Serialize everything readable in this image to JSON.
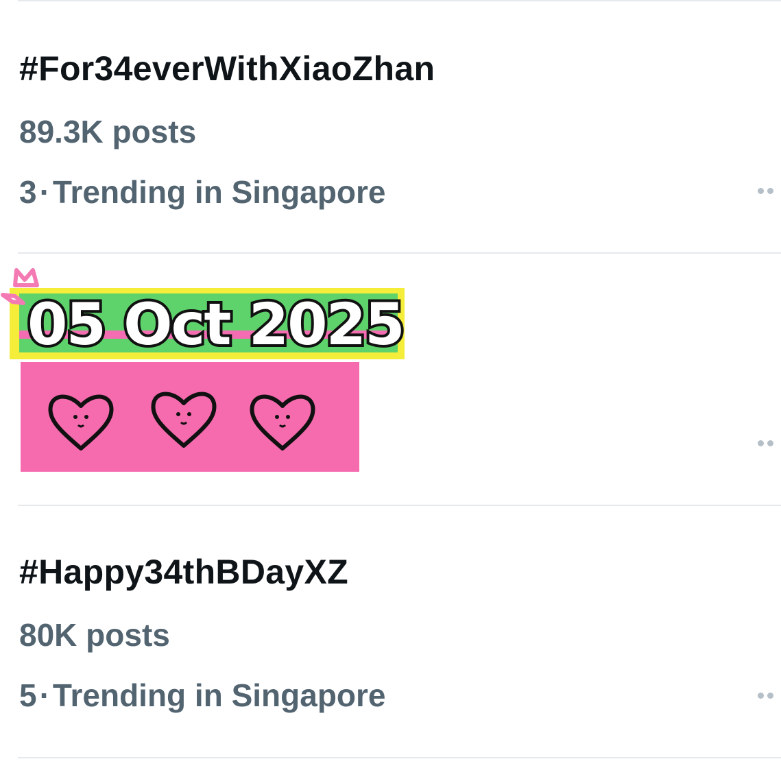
{
  "trends": [
    {
      "hashtag": "#For34everWithXiaoZhan",
      "posts": "89.3K posts",
      "rank": "3",
      "separator": "·",
      "context": "Trending in Singapore",
      "more_icon": "more-horizontal-icon"
    },
    {
      "hashtag": "#Happy34thBDayXZ",
      "posts": "80K posts",
      "rank": "5",
      "separator": "·",
      "context": "Trending in Singapore",
      "more_icon": "more-horizontal-icon"
    }
  ],
  "sticker": {
    "date": "05 Oct 2025",
    "icons": [
      "crown-icon",
      "heart-face-icon",
      "heart-face-icon",
      "heart-face-icon"
    ],
    "colors": {
      "highlight_yellow": "#f4ee3b",
      "stripe_green": "#5ed36c",
      "stripe_pink": "#f46cb1",
      "panel_pink": "#f66aae",
      "crown_pink": "#f47ab4",
      "outline": "#111111"
    }
  },
  "colors": {
    "hashtag_text": "#0f1419",
    "secondary_text": "#536471",
    "divider": "#e6e9ec",
    "more_dots": "#b5bfc8"
  }
}
